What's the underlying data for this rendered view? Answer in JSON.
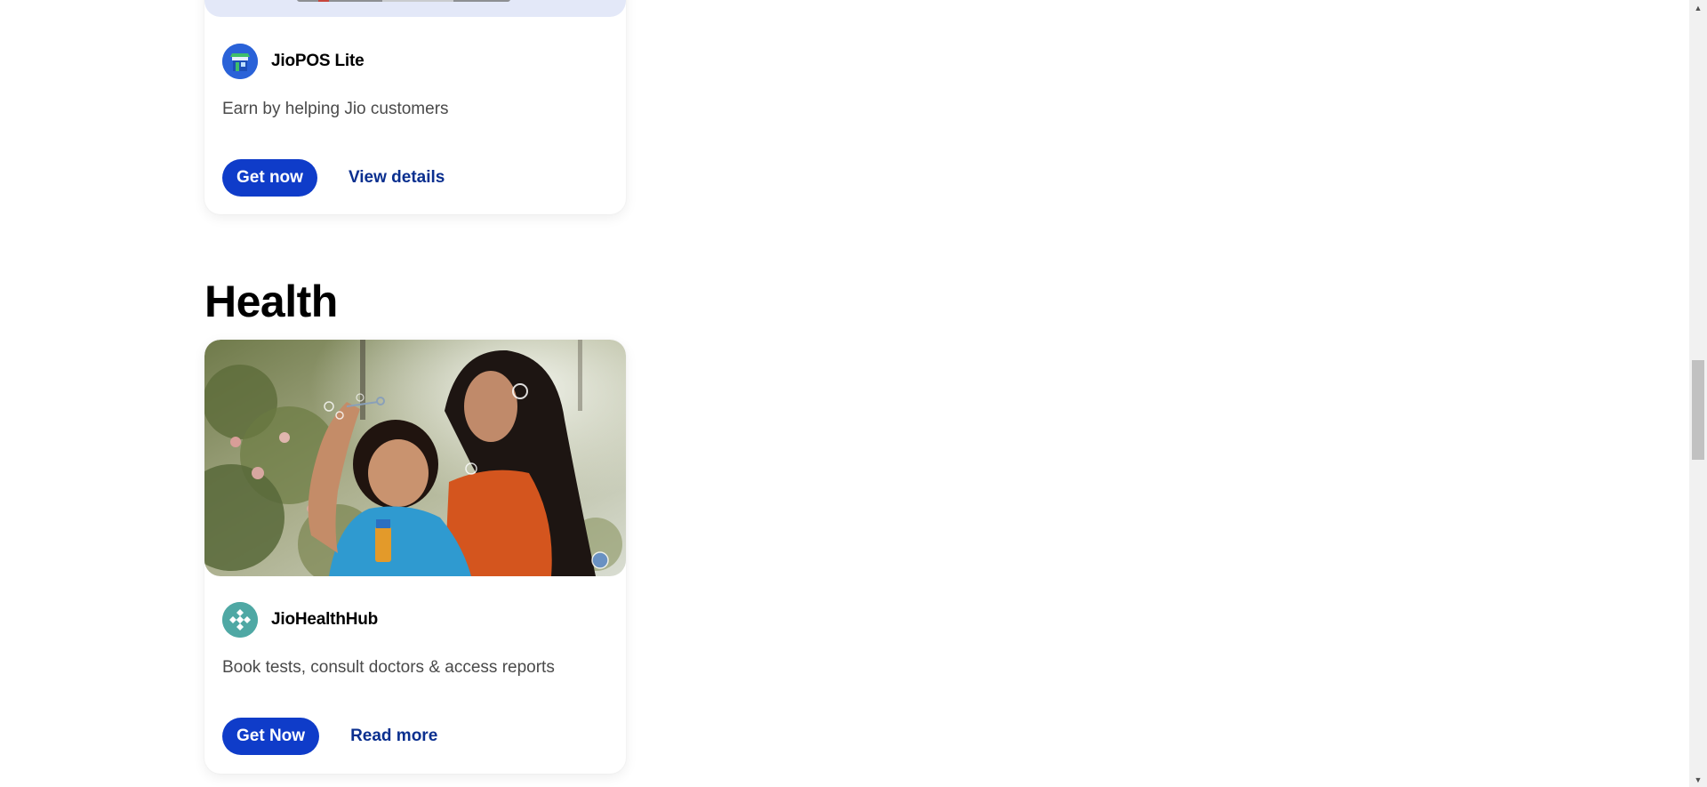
{
  "cards": [
    {
      "icon": "storefront-icon",
      "app_name": "JioPOS Lite",
      "description": "Earn by helping Jio customers",
      "primary_label": "Get now",
      "link_label": "View details"
    },
    {
      "icon": "health-cross-icon",
      "app_name": "JioHealthHub",
      "description": "Book tests, consult doctors & access reports",
      "primary_label": "Get Now",
      "link_label": "Read more"
    }
  ],
  "health_section": {
    "title": "Health",
    "image_alt": "Mother and daughter blowing soap bubbles outdoors"
  },
  "colors": {
    "primary_button": "#0f3cc9",
    "link_text": "#0a2f8f",
    "banner_bg": "#e3e8f8",
    "pos_icon_bg": "#2a62d8",
    "health_icon_bg": "#4fa8a4"
  },
  "scrollbar": {
    "up_icon": "triangle-up-icon",
    "down_icon": "triangle-down-icon"
  }
}
